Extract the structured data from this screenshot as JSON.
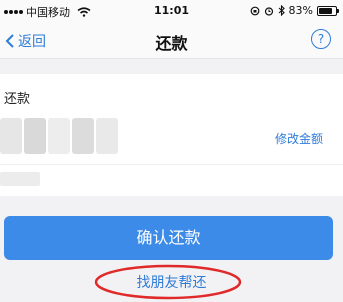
{
  "status_bar": {
    "carrier": "中国移动",
    "time": "11:01",
    "battery_text": "83%",
    "battery_level": 0.83
  },
  "nav": {
    "back_label": "返回",
    "title": "还款",
    "help_glyph": "?"
  },
  "repayment": {
    "label": "还款",
    "modify_amount_label": "修改金额"
  },
  "actions": {
    "confirm_label": "确认还款",
    "friend_repay_label": "找朋友帮还"
  },
  "colors": {
    "accent": "#3c8be8",
    "link": "#2f7bd9",
    "annotation": "#e02a2a"
  }
}
